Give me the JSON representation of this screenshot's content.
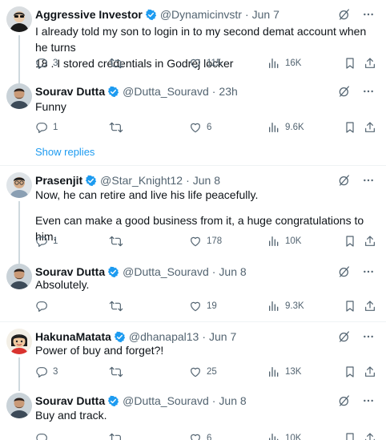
{
  "colors": {
    "accent": "#1d9bf0",
    "text": "#0f1419",
    "muted": "#536471",
    "divider": "#eff3f4"
  },
  "show_replies": "Show replies",
  "tweets": [
    {
      "name": "Aggressive Investor",
      "handle": "@Dynamicinvstr",
      "dot": "·",
      "time": "Jun 7",
      "lines": [
        "I already told my son to login in to my second demat account when he turns",
        "18 . I stored credentials in Godrej locker"
      ],
      "replies": "3",
      "retweets": "",
      "likes": "115",
      "views": "16K",
      "avatar": "avatar-dark"
    },
    {
      "name": "Sourav Dutta",
      "handle": "@Dutta_Souravd",
      "dot": "·",
      "time": "23h",
      "lines": [
        "Funny"
      ],
      "replies": "1",
      "retweets": "",
      "likes": "6",
      "views": "9.6K",
      "avatar": "avatar-man"
    },
    {
      "name": "Prasenjit",
      "handle": "@Star_Knight12",
      "dot": "·",
      "time": "Jun 8",
      "lines": [
        "Now, he can retire and live his life peacefully.",
        "",
        "Even can make a good business from it, a huge congratulations to him."
      ],
      "replies": "1",
      "retweets": "",
      "likes": "178",
      "views": "10K",
      "avatar": "avatar-glasses"
    },
    {
      "name": "Sourav Dutta",
      "handle": "@Dutta_Souravd",
      "dot": "·",
      "time": "Jun 8",
      "lines": [
        "Absolutely."
      ],
      "replies": "",
      "retweets": "",
      "likes": "19",
      "views": "9.3K",
      "avatar": "avatar-man"
    },
    {
      "name": "HakunaMatata",
      "handle": "@dhanapal13",
      "dot": "·",
      "time": "Jun 7",
      "lines": [
        "Power of buy and forget?!"
      ],
      "replies": "3",
      "retweets": "",
      "likes": "25",
      "views": "13K",
      "avatar": "avatar-cartoon"
    },
    {
      "name": "Sourav Dutta",
      "handle": "@Dutta_Souravd",
      "dot": "·",
      "time": "Jun 8",
      "lines": [
        "Buy and track."
      ],
      "replies": "",
      "retweets": "",
      "likes": "6",
      "views": "10K",
      "avatar": "avatar-man"
    }
  ]
}
